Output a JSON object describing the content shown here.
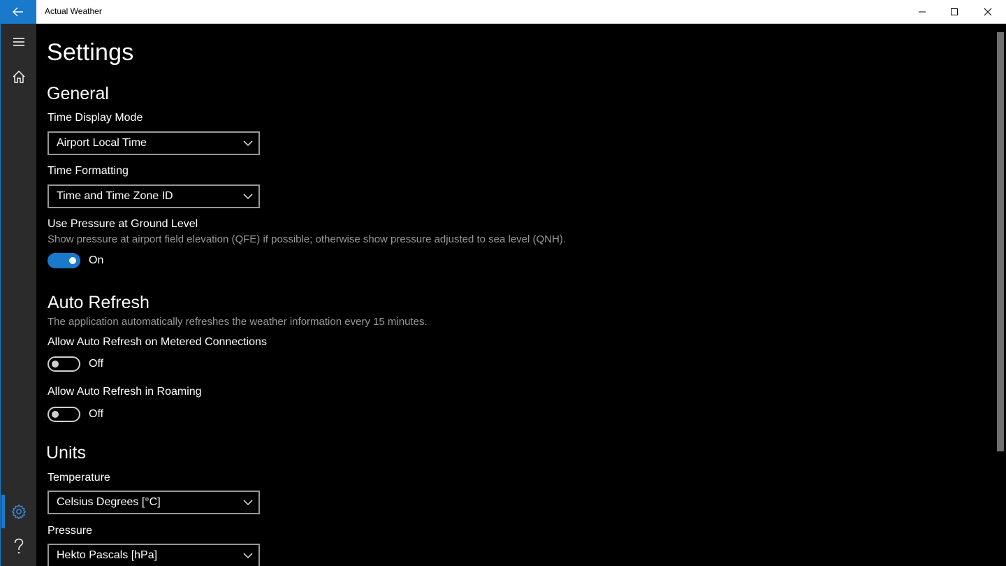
{
  "window": {
    "title": "Actual Weather",
    "back_icon": "arrow-left-icon",
    "accent_color": "#1979ca"
  },
  "rail": {
    "items": [
      {
        "icon": "hamburger-menu-icon"
      },
      {
        "icon": "home-icon"
      },
      {
        "icon": "gear-icon",
        "selected": true
      },
      {
        "icon": "question-mark-icon"
      }
    ]
  },
  "page": {
    "title": "Settings"
  },
  "general": {
    "heading": "General",
    "time_display_mode": {
      "label": "Time Display Mode",
      "value": "Airport Local Time"
    },
    "time_formatting": {
      "label": "Time Formatting",
      "value": "Time and Time Zone ID"
    },
    "ground_pressure": {
      "label": "Use Pressure at Ground Level",
      "description": "Show pressure at airport field elevation (QFE) if possible; otherwise show pressure adjusted to sea level (QNH).",
      "state": "On"
    }
  },
  "auto_refresh": {
    "heading": "Auto Refresh",
    "description": "The application automatically refreshes the weather information every 15 minutes.",
    "metered": {
      "label": "Allow Auto Refresh on Metered Connections",
      "state": "Off"
    },
    "roaming": {
      "label": "Allow Auto Refresh in Roaming",
      "state": "Off"
    }
  },
  "units": {
    "heading": "Units",
    "temperature": {
      "label": "Temperature",
      "value": "Celsius Degrees [°C]"
    },
    "pressure": {
      "label": "Pressure",
      "value": "Hekto Pascals [hPa]"
    }
  }
}
